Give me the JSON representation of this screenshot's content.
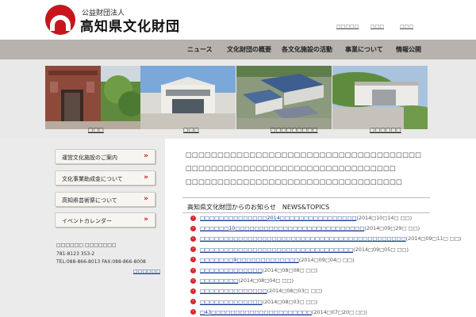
{
  "header": {
    "logo_sub": "公益財団法人",
    "logo_name": "高知県文化財団",
    "util_links": [
      "□□□□□",
      "□□□",
      "□□□"
    ]
  },
  "nav": {
    "items": [
      "ニュース",
      "文化財団の概要",
      "各文化施設の活動",
      "事業について",
      "情報公開"
    ]
  },
  "photos": {
    "captions": [
      "□□□",
      "□□□",
      "□□□□□□□□□",
      "□□□□□□"
    ]
  },
  "sidebar": {
    "buttons": [
      "運営文化施設のご案内",
      "文化事業助成金について",
      "高知県芸術祭について",
      "イベントカレンダー"
    ],
    "arrows": "»",
    "contact": [
      "□□□□□□ □□□□□□□",
      "781-8123       353-2",
      "TEL:088-866-8013 FAX:088-866-8008"
    ],
    "link": "□□□□□□"
  },
  "main": {
    "intro": [
      "□□□□□□□□□□□□□□□□□□□□□□□□□□□□□□□□□□□□□",
      "□□□□□□□□□□□□□□□□□□□□□□□□□□□□□□□□□",
      "□□□□□□□□□□□□□□□□□□□□□□□□□□□□□□□□□□"
    ],
    "news_heading": "高知県文化財団からのお知らせ",
    "news_heading_en": "NEWS&TOPICS",
    "news": [
      {
        "title": "□□□□□□□□□□□□□□2014□□□□□□□□□□□□□□□□",
        "date": "(2014□10□14□ □□)"
      },
      {
        "title": "□□□□□□10□□□□□□□□□□□□□□□□□□□□□□□□□□□",
        "date": "(2014□09□29□ □□)"
      },
      {
        "title": "□□□□□□□□□□□□□□□□□□□□□□□□□□□□□□□□□□□□□□□□□□□",
        "date": "(2014□09□11□ □□)"
      },
      {
        "title": "□□□□□□□□□□□□□□□□□□□□□□□□□□□□□□□□",
        "date": "(2014□09□05□ □□)"
      },
      {
        "title": "□□□□□□□9□□□□□□□□□□□□□",
        "date": "(2014□09□04□ □□)"
      },
      {
        "title": "□□□□□□□□□□□□□",
        "date": "(2014□08□08□ □□)"
      },
      {
        "title": "□□□□□□□□",
        "date": "(2014□08□04□ □□)"
      },
      {
        "title": "□□□□□□□□□□□□□□",
        "date": "(2014□08□03□ □□)"
      },
      {
        "title": "□□□□□□□□□□□□□",
        "date": "(2014□08□03□ □□)"
      },
      {
        "title": "□43□□□□□□□□□□□□□□□□□□□□□",
        "date": "(2014□07□20□ □□)"
      }
    ]
  },
  "colors": {
    "brand_red": "#c8151d",
    "nav_bg": "#b7b2ad",
    "link_blue": "#1a3d8f"
  }
}
